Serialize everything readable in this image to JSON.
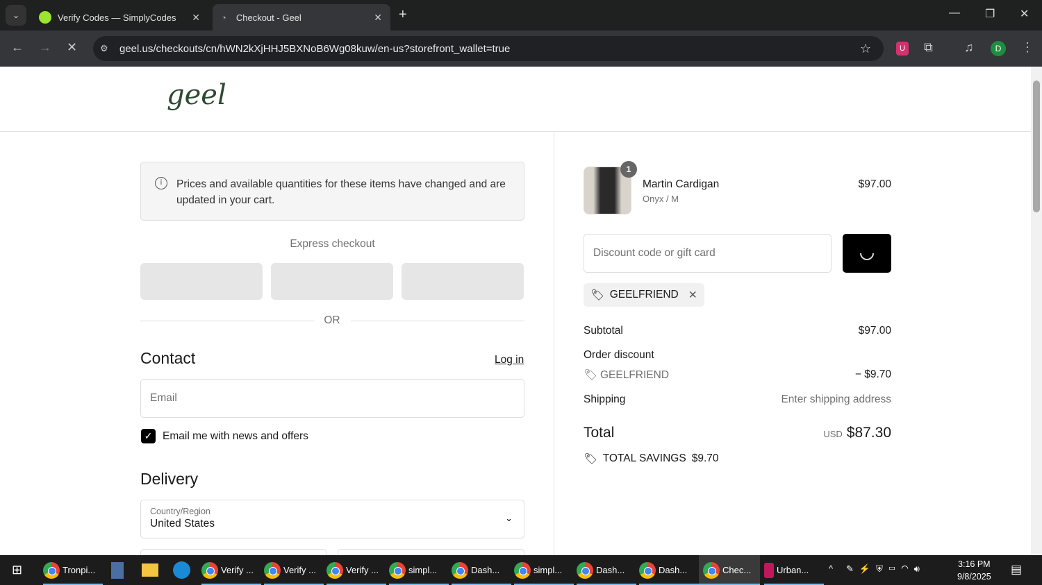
{
  "browser": {
    "tabs": [
      {
        "title": "Verify Codes — SimplyCodes"
      },
      {
        "title": "Checkout - Geel"
      }
    ],
    "url": "geel.us/checkouts/cn/hWN2kXjHHJ5BXNoB6Wg08kuw/en-us?storefront_wallet=true",
    "profile_initial": "D",
    "ext_badge": "U"
  },
  "brand": {
    "logo": "geel"
  },
  "notice": "Prices and available quantities for these items have changed and are updated in your cart.",
  "express": {
    "label": "Express checkout",
    "or": "OR"
  },
  "contact": {
    "title": "Contact",
    "login": "Log in",
    "email_placeholder": "Email",
    "newsletter": "Email me with news and offers",
    "newsletter_checked": true
  },
  "delivery": {
    "title": "Delivery",
    "country_label": "Country/Region",
    "country_value": "United States"
  },
  "cart": {
    "item": {
      "name": "Martin Cardigan",
      "variant": "Onyx / M",
      "price": "$97.00",
      "qty": "1"
    },
    "discount_placeholder": "Discount code or gift card",
    "applied_code": "GEELFRIEND",
    "subtotal_label": "Subtotal",
    "subtotal": "$97.00",
    "order_discount_label": "Order discount",
    "discount_code": "GEELFRIEND",
    "discount_amount": "− $9.70",
    "shipping_label": "Shipping",
    "shipping_value": "Enter shipping address",
    "total_label": "Total",
    "currency": "USD",
    "total": "$87.30",
    "savings_label": "TOTAL SAVINGS",
    "savings": "$9.70"
  },
  "taskbar": {
    "items": [
      "Tronpi...",
      "Verify ...",
      "Verify ...",
      "Verify ...",
      "simpl...",
      "Dash...",
      "simpl...",
      "Dash...",
      "Dash...",
      "Chec...",
      "Urban..."
    ],
    "time": "3:16 PM",
    "date": "9/8/2025"
  }
}
